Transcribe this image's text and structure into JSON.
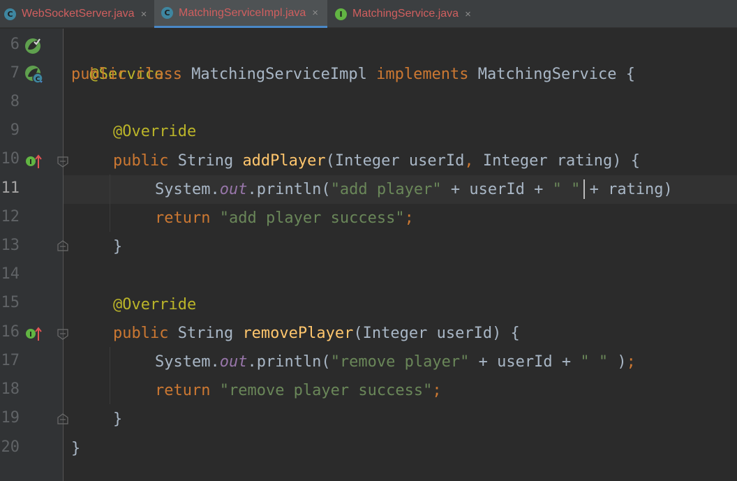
{
  "tabs": [
    {
      "label": "WebSocketServer.java",
      "type": "C",
      "active": false
    },
    {
      "label": "MatchingServiceImpl.java",
      "type": "C",
      "active": true
    },
    {
      "label": "MatchingService.java",
      "type": "I",
      "active": false
    }
  ],
  "close_glyph": "×",
  "line_numbers": [
    "6",
    "7",
    "8",
    "9",
    "10",
    "11",
    "12",
    "13",
    "14",
    "15",
    "16",
    "17",
    "18",
    "19",
    "20"
  ],
  "current_line": "11",
  "code": {
    "l6": {
      "ann": "@Service"
    },
    "l7": {
      "kw1": "public class ",
      "cls": "MatchingServiceImpl ",
      "kw2": "implements ",
      "iface": "MatchingService {"
    },
    "l9": {
      "ann": "@Override"
    },
    "l10": {
      "kw": "public ",
      "type": "String ",
      "fn": "addPlayer",
      "p1": "(Integer userId",
      "comma": ", ",
      "p2": "Integer rating) {"
    },
    "l11": {
      "sys": "System.",
      "fld": "out",
      "call": ".println(",
      "s1": "\"add player\"",
      "mid": " + userId ",
      "cursor_after": "+ ",
      "s2": "\" \"",
      "end": " + rating)"
    },
    "l12": {
      "kw": "return ",
      "str": "\"add player success\"",
      "semi": ";"
    },
    "l13": {
      "brace": "}"
    },
    "l15": {
      "ann": "@Override"
    },
    "l16": {
      "kw": "public ",
      "type": "String ",
      "fn": "removePlayer",
      "params": "(Integer userId) {"
    },
    "l17": {
      "sys": "System.",
      "fld": "out",
      "call": ".println(",
      "s1": "\"remove player\"",
      "mid": " + userId + ",
      "s2": "\" \"",
      "end": " )",
      "semi": ";"
    },
    "l18": {
      "kw": "return ",
      "str": "\"remove player success\"",
      "semi": ";"
    },
    "l19": {
      "brace": "}"
    },
    "l20": {
      "brace": "}"
    }
  },
  "colors": {
    "background": "#2b2b2b",
    "keyword": "#cc7832",
    "annotation": "#bbb529",
    "method": "#ffc66d",
    "string": "#6a8759",
    "field": "#9876aa",
    "text": "#a9b7c6"
  },
  "icons": {
    "service": "spring-bean-icon",
    "impl_class": "implemented-class-icon",
    "override": "implements-method-icon",
    "fold": "fold-marker-icon"
  }
}
